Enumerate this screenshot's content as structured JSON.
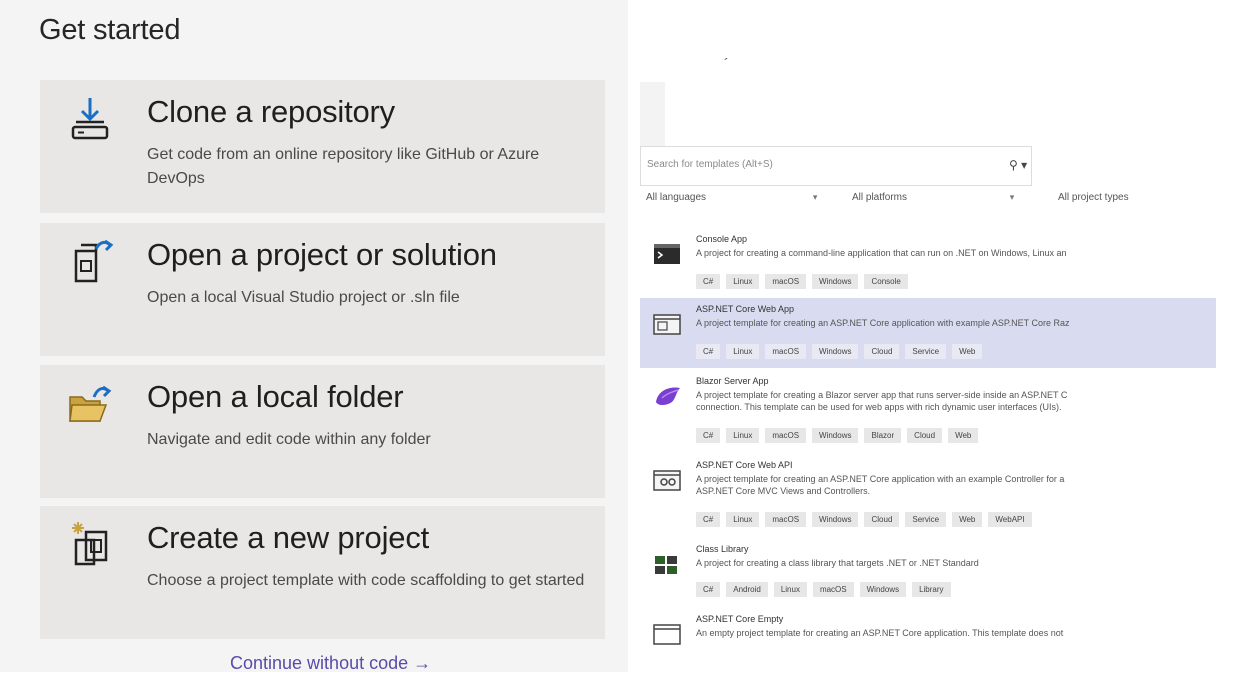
{
  "get_started": {
    "heading": "Get started",
    "cards": [
      {
        "title": "Clone a repository",
        "description": "Get code from an online repository like GitHub or Azure DevOps",
        "icon": "clone-repository-icon"
      },
      {
        "title": "Open a project or solution",
        "description": "Open a local Visual Studio project or .sln file",
        "icon": "open-project-icon"
      },
      {
        "title": "Open a local folder",
        "description": "Navigate and edit code within any folder",
        "icon": "open-folder-icon"
      },
      {
        "title": "Create a new project",
        "description": "Choose a project template with code scaffolding to get started",
        "icon": "new-project-icon"
      }
    ],
    "continue_link": "Continue without code →"
  },
  "templates": {
    "search_placeholder": "Search for templates (Alt+S)",
    "search_icon": "search-icon",
    "filters": {
      "languages": "All languages",
      "platforms": "All platforms",
      "project_types": "All project types"
    },
    "items": [
      {
        "name": "Console App",
        "description": "A project for creating a command-line application that can run on .NET on Windows, Linux an",
        "tags": [
          "C#",
          "Linux",
          "macOS",
          "Windows",
          "Console"
        ],
        "icon": "console-app-icon"
      },
      {
        "name": "ASP.NET Core Web App",
        "description": "A project template for creating an ASP.NET Core application with example ASP.NET Core Raz",
        "tags": [
          "C#",
          "Linux",
          "macOS",
          "Windows",
          "Cloud",
          "Service",
          "Web"
        ],
        "icon": "web-app-icon"
      },
      {
        "name": "Blazor Server App",
        "description": "A project template for creating a Blazor server app that runs server-side inside an ASP.NET C",
        "description_2": "connection. This template can be used for web apps with rich dynamic user interfaces (UIs).",
        "tags": [
          "C#",
          "Linux",
          "macOS",
          "Windows",
          "Blazor",
          "Cloud",
          "Web"
        ],
        "icon": "blazor-icon"
      },
      {
        "name": "ASP.NET Core Web API",
        "description": "A project template for creating an ASP.NET Core application with an example Controller for a",
        "description_2": "ASP.NET Core MVC Views and Controllers.",
        "tags": [
          "C#",
          "Linux",
          "macOS",
          "Windows",
          "Cloud",
          "Service",
          "Web",
          "WebAPI"
        ],
        "icon": "web-api-icon"
      },
      {
        "name": "Class Library",
        "description": "A project for creating a class library that targets .NET or .NET Standard",
        "tags": [
          "C#",
          "Android",
          "Linux",
          "macOS",
          "Windows",
          "Library"
        ],
        "icon": "class-library-icon"
      },
      {
        "name": "ASP.NET Core Empty",
        "description": "An empty project template for creating an ASP.NET Core application. This template does not",
        "tags": [],
        "icon": "empty-web-icon"
      }
    ]
  },
  "colors": {
    "card_bg": "#e9e6e6",
    "selected_row": "#d9dcf1",
    "link": "#5b4aa8"
  }
}
